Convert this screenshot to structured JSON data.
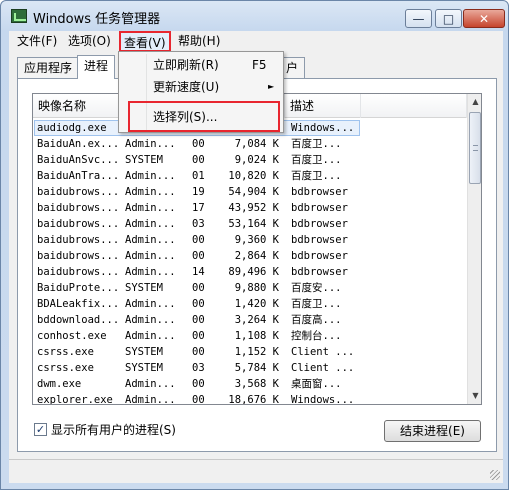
{
  "window": {
    "title": "Windows 任务管理器"
  },
  "menu": {
    "file": "文件(F)",
    "options": "选项(O)",
    "view": "查看(V)",
    "help": "帮助(H)"
  },
  "view_menu": {
    "refresh_now": "立即刷新(R)",
    "refresh_shortcut": "F5",
    "update_speed": "更新速度(U)",
    "select_columns": "选择列(S)..."
  },
  "tabs": {
    "applications": "应用程序",
    "processes": "进程",
    "users_partial": "户"
  },
  "columns": {
    "image_name": "映像名称",
    "description": "描述"
  },
  "processes": [
    {
      "name": "audiodg.exe",
      "user": "",
      "cpu": "",
      "mem": "",
      "desc": "Windows..."
    },
    {
      "name": "BaiduAn.ex...",
      "user": "Admin...",
      "cpu": "00",
      "mem": "7,084 K",
      "desc": "百度卫..."
    },
    {
      "name": "BaiduAnSvc...",
      "user": "SYSTEM",
      "cpu": "00",
      "mem": "9,024 K",
      "desc": "百度卫..."
    },
    {
      "name": "BaiduAnTra...",
      "user": "Admin...",
      "cpu": "01",
      "mem": "10,820 K",
      "desc": "百度卫..."
    },
    {
      "name": "baidubrows...",
      "user": "Admin...",
      "cpu": "19",
      "mem": "54,904 K",
      "desc": "bdbrowser"
    },
    {
      "name": "baidubrows...",
      "user": "Admin...",
      "cpu": "17",
      "mem": "43,952 K",
      "desc": "bdbrowser"
    },
    {
      "name": "baidubrows...",
      "user": "Admin...",
      "cpu": "03",
      "mem": "53,164 K",
      "desc": "bdbrowser"
    },
    {
      "name": "baidubrows...",
      "user": "Admin...",
      "cpu": "00",
      "mem": "9,360 K",
      "desc": "bdbrowser"
    },
    {
      "name": "baidubrows...",
      "user": "Admin...",
      "cpu": "00",
      "mem": "2,864 K",
      "desc": "bdbrowser"
    },
    {
      "name": "baidubrows...",
      "user": "Admin...",
      "cpu": "14",
      "mem": "89,496 K",
      "desc": "bdbrowser"
    },
    {
      "name": "BaiduProte...",
      "user": "SYSTEM",
      "cpu": "00",
      "mem": "9,880 K",
      "desc": "百度安..."
    },
    {
      "name": "BDALeakfix...",
      "user": "Admin...",
      "cpu": "00",
      "mem": "1,420 K",
      "desc": "百度卫..."
    },
    {
      "name": "bddownload...",
      "user": "Admin...",
      "cpu": "00",
      "mem": "3,264 K",
      "desc": "百度高..."
    },
    {
      "name": "conhost.exe",
      "user": "Admin...",
      "cpu": "00",
      "mem": "1,108 K",
      "desc": "控制台..."
    },
    {
      "name": "csrss.exe",
      "user": "SYSTEM",
      "cpu": "00",
      "mem": "1,152 K",
      "desc": "Client ..."
    },
    {
      "name": "csrss.exe",
      "user": "SYSTEM",
      "cpu": "03",
      "mem": "5,784 K",
      "desc": "Client ..."
    },
    {
      "name": "dwm.exe",
      "user": "Admin...",
      "cpu": "00",
      "mem": "3,568 K",
      "desc": "桌面窗..."
    },
    {
      "name": "explorer.exe",
      "user": "Admin...",
      "cpu": "00",
      "mem": "18,676 K",
      "desc": "Windows..."
    }
  ],
  "footer": {
    "show_all_users": "显示所有用户的进程(S)",
    "show_all_checked": "✓",
    "end_process": "结束进程(E)"
  },
  "icons": {
    "minimize": "—",
    "maximize": "□",
    "close": "✕",
    "submenu_arrow": "►",
    "scroll_up": "▲",
    "scroll_down": "▼"
  },
  "colors": {
    "highlight_box": "#e8262f",
    "selection": "#e8f1fc"
  }
}
